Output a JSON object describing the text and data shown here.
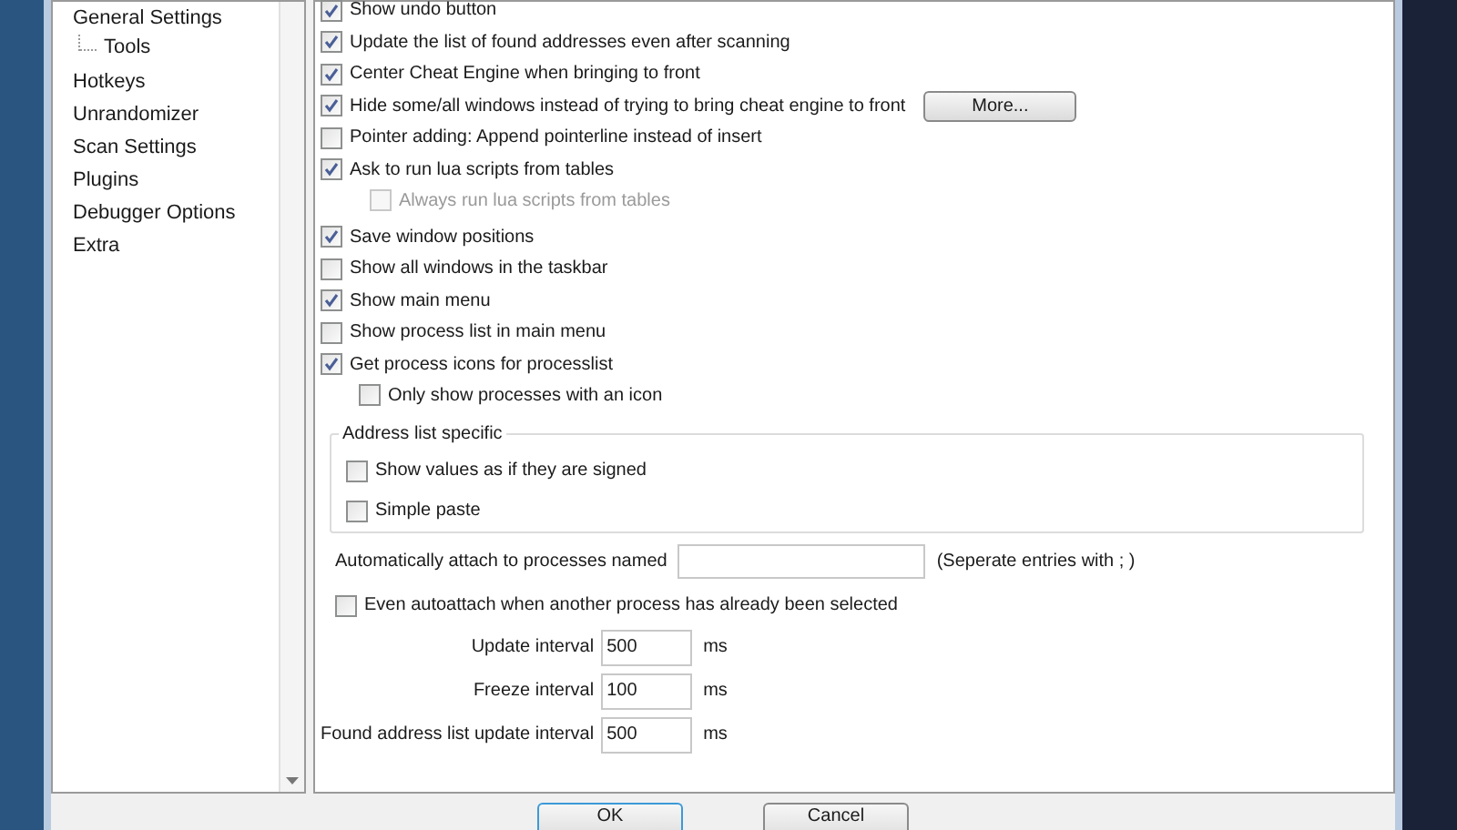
{
  "sidebar": {
    "items": [
      {
        "label": "General Settings",
        "selected": false,
        "children": [
          {
            "label": "Tools",
            "selected": false
          }
        ]
      },
      {
        "label": "Hotkeys",
        "selected": false
      },
      {
        "label": "Unrandomizer",
        "selected": false
      },
      {
        "label": "Scan Settings",
        "selected": false
      },
      {
        "label": "Plugins",
        "selected": false
      },
      {
        "label": "Debugger Options",
        "selected": false
      },
      {
        "label": "Extra",
        "selected": false
      }
    ]
  },
  "option_groups": [
    [
      {
        "label": "Show undo button",
        "checked": true,
        "disabled": false
      },
      {
        "label": "Update the list of found addresses even after scanning",
        "checked": true,
        "disabled": false
      },
      {
        "label": "Center Cheat Engine when bringing to front",
        "checked": true,
        "disabled": false
      },
      {
        "label": "Hide some/all windows instead of trying to bring cheat engine to front",
        "checked": true,
        "disabled": false,
        "button": "More..."
      },
      {
        "label": "Pointer adding: Append pointerline instead of insert",
        "checked": false,
        "disabled": false
      },
      {
        "label": "Ask to run lua scripts from tables",
        "checked": true,
        "disabled": false,
        "children": [
          {
            "label": "Always run lua scripts from tables",
            "checked": false,
            "disabled": true
          }
        ]
      }
    ],
    [
      {
        "label": "Save window positions",
        "checked": true,
        "disabled": false
      },
      {
        "label": "Show all windows in the taskbar",
        "checked": false,
        "disabled": false
      },
      {
        "label": "Show main menu",
        "checked": true,
        "disabled": false
      },
      {
        "label": "Show process list in main menu",
        "checked": false,
        "disabled": false
      },
      {
        "label": "Get process icons for processlist",
        "checked": true,
        "disabled": false,
        "children": [
          {
            "label": "Only show processes with an icon",
            "checked": false,
            "disabled": false
          }
        ]
      }
    ]
  ],
  "address_list_group": {
    "title": "Address list specific",
    "options": [
      {
        "label": "Show values as if they are signed",
        "checked": false,
        "disabled": false
      },
      {
        "label": "Simple paste",
        "checked": false,
        "disabled": false
      }
    ]
  },
  "autoattach": {
    "label": "Automatically attach to processes named",
    "hint": "(Seperate entries with ; )"
  },
  "even_autoattach": {
    "label": "Even autoattach when another process has already been selected",
    "checked": false,
    "disabled": false
  },
  "intervals": [
    {
      "label": "Update interval",
      "value": "500",
      "unit": "ms"
    },
    {
      "label": "Freeze interval",
      "value": "100",
      "unit": "ms"
    },
    {
      "label": "Found address list update interval",
      "value": "500",
      "unit": "ms"
    }
  ],
  "buttons": [
    {
      "label": "OK",
      "focused": true
    },
    {
      "label": "Cancel",
      "focused": false
    }
  ]
}
